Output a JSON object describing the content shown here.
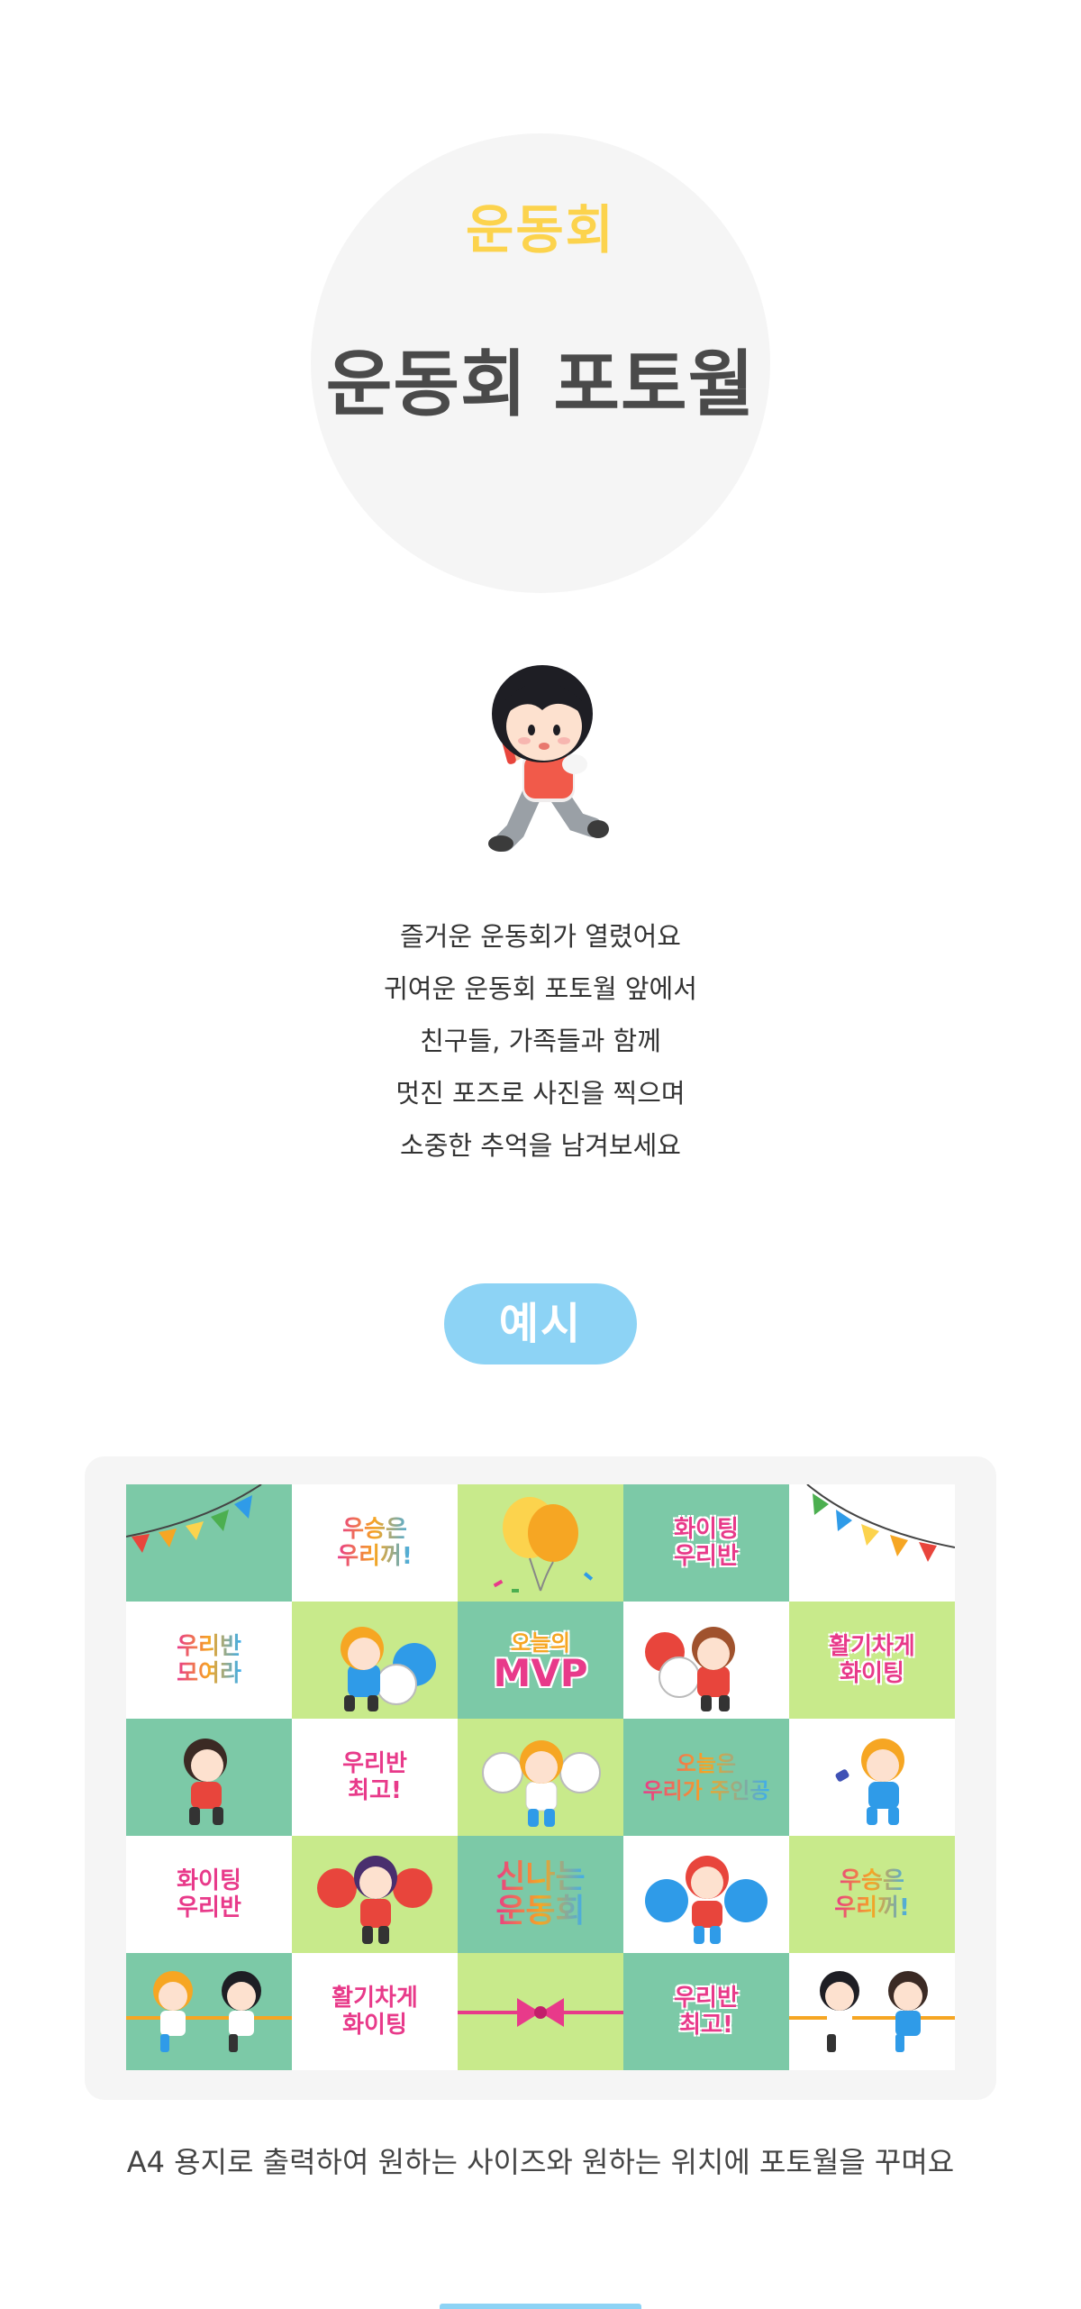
{
  "hero": {
    "subtitle": "운동회",
    "title": "운동회 포토월"
  },
  "intro": {
    "lines": [
      "즐거운 운동회가 열렸어요",
      "귀여운 운동회 포토월 앞에서",
      "친구들, 가족들과 함께",
      "멋진 포즈로 사진을 찍으며",
      "소중한 추억을 남겨보세요"
    ]
  },
  "example": {
    "label": "예시"
  },
  "stickers": {
    "win_1": "우승은\n우리꺼!",
    "fighting_class_1": "화이팅\n우리반",
    "gather": "우리반\n모여라",
    "mvp_top": "오늘의",
    "mvp": "MVP",
    "energetic_1": "활기차게\n화이팅",
    "best_1": "우리반\n최고!",
    "today_main": "오늘은\n우리가 주인공",
    "fighting_class_2": "화이팅\n우리반",
    "exciting": "신나는\n운동회",
    "win_2": "우승은\n우리꺼!",
    "energetic_2": "활기차게\n화이팅",
    "best_2": "우리반\n최고!"
  },
  "caption": "A4 용지로 출력하여 원하는 사이즈와 원하는 위치에 포토월을 꾸며요",
  "colors": {
    "accent_blue": "#8dd3f5",
    "accent_yellow": "#fcd34d",
    "grid_teal": "#7cc9a7",
    "grid_lime": "#c8ea8b"
  }
}
